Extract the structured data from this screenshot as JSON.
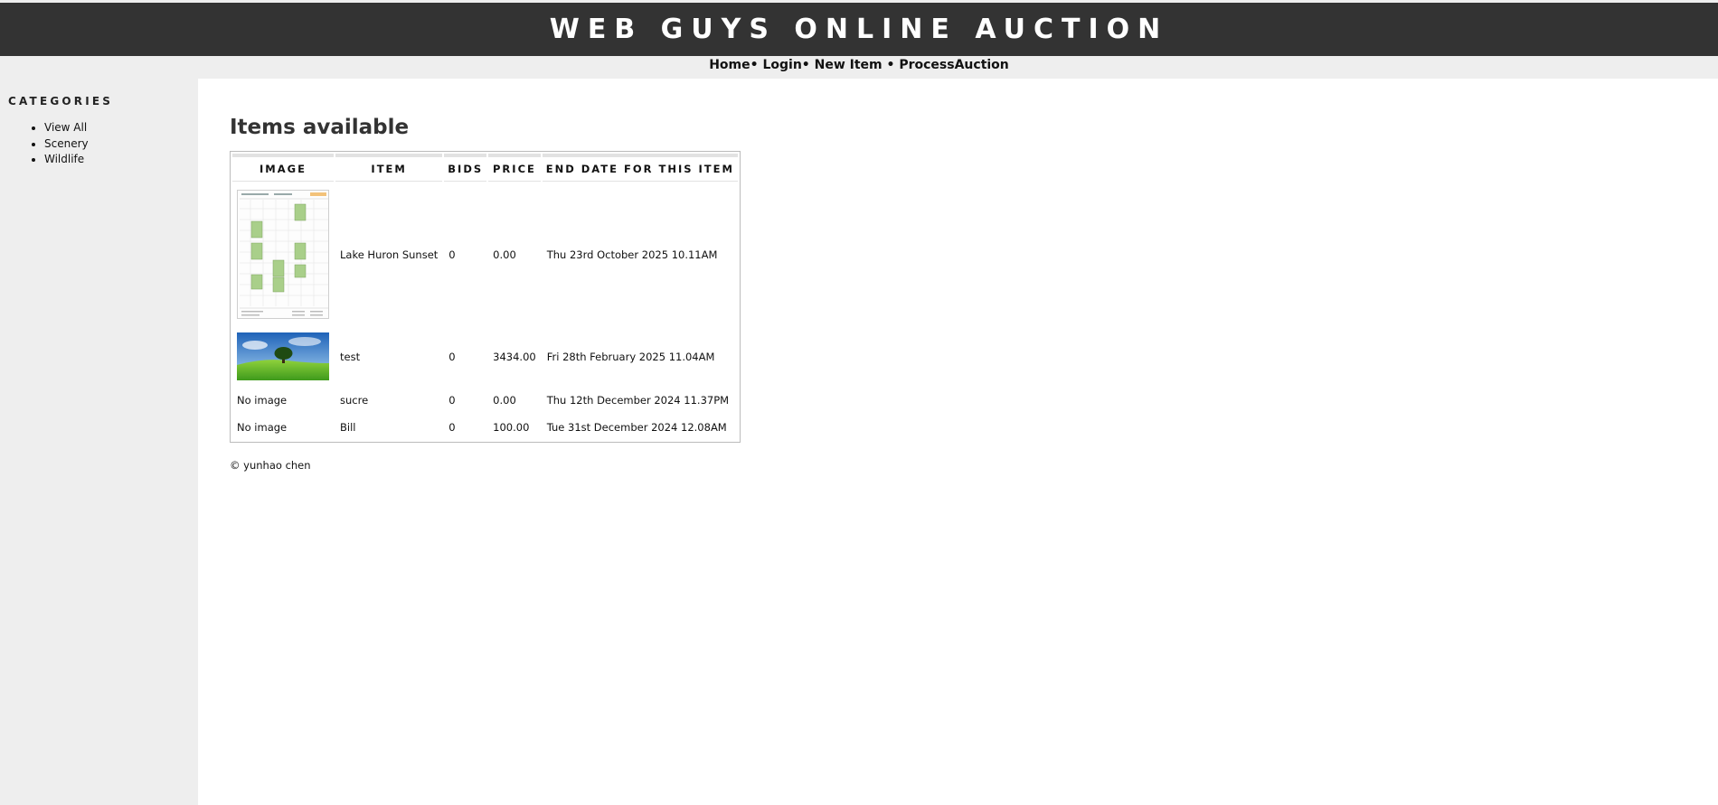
{
  "header": {
    "title": "WEB GUYS ONLINE AUCTION"
  },
  "nav": {
    "items": [
      "Home",
      "Login",
      "New Item",
      "ProcessAuction"
    ],
    "separator": "•"
  },
  "sidebar": {
    "heading": "CATEGORIES",
    "items": [
      "View All",
      "Scenery",
      "Wildlife"
    ]
  },
  "main": {
    "title": "Items available",
    "table": {
      "headers": [
        "IMAGE",
        "ITEM",
        "BIDS",
        "PRICE",
        "END DATE FOR THIS ITEM"
      ],
      "rows": [
        {
          "image": "calendar-screenshot-thumbnail",
          "image_text": "",
          "item": "Lake Huron Sunset",
          "bids": "0",
          "price": "0.00",
          "end_date": "Thu 23rd October 2025 10.11AM"
        },
        {
          "image": "tree-on-hill-thumbnail",
          "image_text": "",
          "item": "test",
          "bids": "0",
          "price": "3434.00",
          "end_date": "Fri 28th February 2025 11.04AM"
        },
        {
          "image": "none",
          "image_text": "No image",
          "item": "sucre",
          "bids": "0",
          "price": "0.00",
          "end_date": "Thu 12th December 2024 11.37PM"
        },
        {
          "image": "none",
          "image_text": "No image",
          "item": "Bill",
          "bids": "0",
          "price": "100.00",
          "end_date": "Tue 31st December 2024 12.08AM"
        }
      ]
    }
  },
  "footer": {
    "text": "© yunhao chen"
  },
  "colors": {
    "header_bg": "#333333",
    "sidebar_bg": "#eeeeee",
    "main_bg": "#ffffff"
  }
}
